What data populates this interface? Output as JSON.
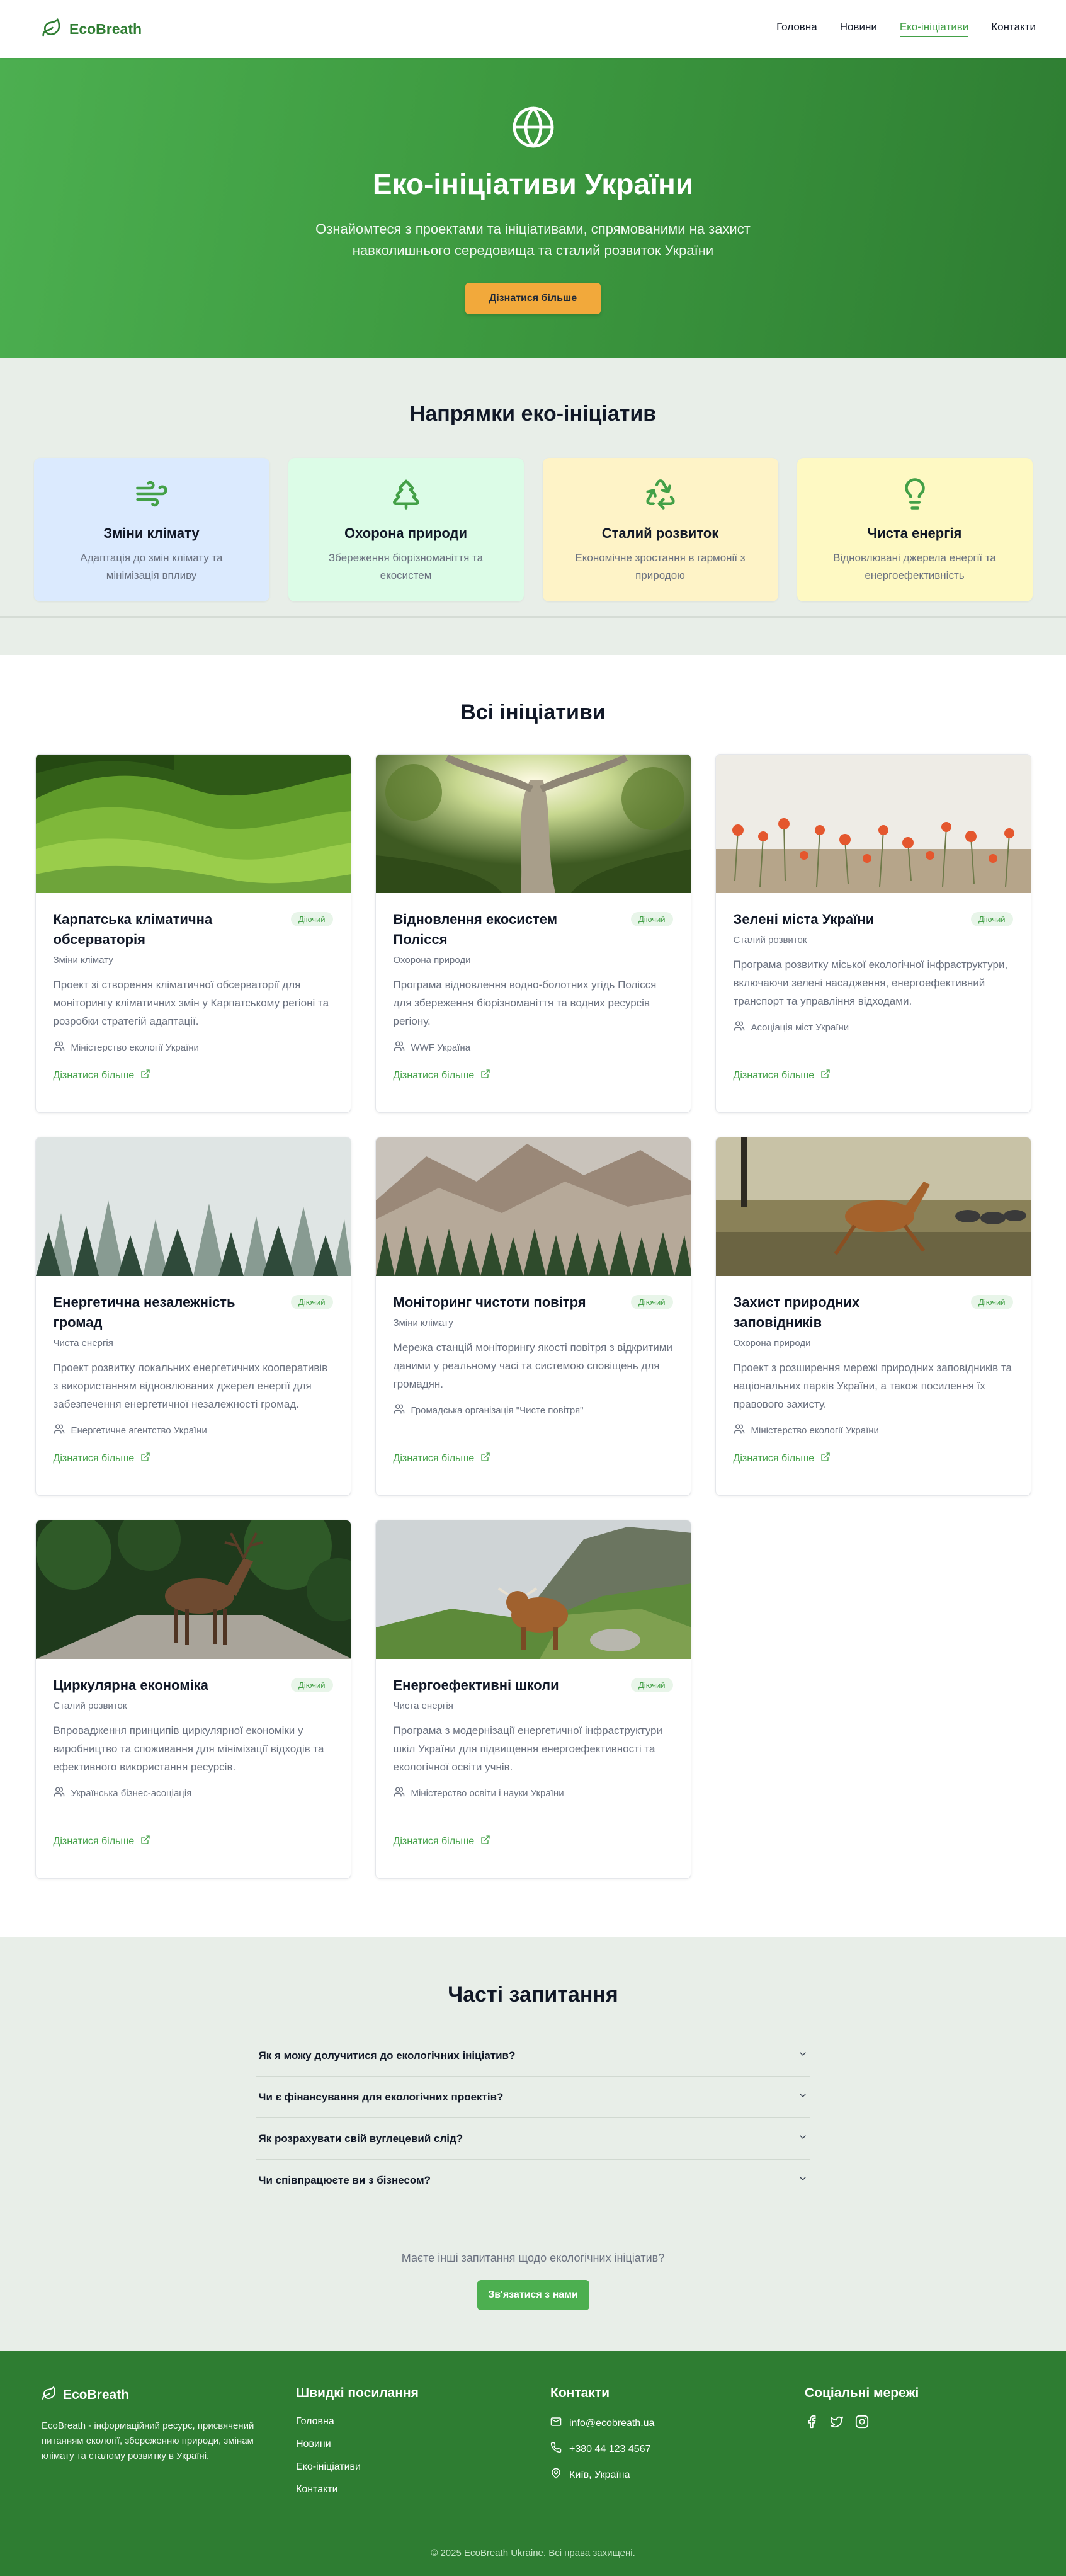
{
  "header": {
    "logo_text": "EcoBreath",
    "nav": [
      {
        "label": "Головна",
        "active": false
      },
      {
        "label": "Новини",
        "active": false
      },
      {
        "label": "Еко-ініціативи",
        "active": true
      },
      {
        "label": "Контакти",
        "active": false
      }
    ]
  },
  "hero": {
    "title": "Еко-ініціативи України",
    "subtitle": "Ознайомтеся з проектами та ініціативами, спрямованими на захист навколишнього середовища та сталий розвиток України",
    "button": "Дізнатися більше"
  },
  "directions": {
    "title": "Напрямки еко-ініціатив",
    "items": [
      {
        "icon": "wind-icon",
        "title": "Зміни клімату",
        "desc": "Адаптація до змін клімату та мінімізація впливу",
        "bg": "#dbeafe"
      },
      {
        "icon": "tree-icon",
        "title": "Охорона природи",
        "desc": "Збереження біорізноманіття та екосистем",
        "bg": "#dcfce7"
      },
      {
        "icon": "recycle-icon",
        "title": "Сталий розвиток",
        "desc": "Економічне зростання в гармонії з природою",
        "bg": "#fef3c7"
      },
      {
        "icon": "lightbulb-icon",
        "title": "Чиста енергія",
        "desc": "Відновлювані джерела енергії та енергоефективність",
        "bg": "#fef9c3"
      }
    ]
  },
  "initiatives": {
    "title": "Всі ініціативи",
    "items": [
      {
        "title": "Карпатська кліматична обсерваторія",
        "status": "Діючий",
        "category": "Зміни клімату",
        "desc": "Проект зі створення кліматичної обсерваторії для моніторингу кліматичних змін у Карпатському регіоні та розробки стратегій адаптації.",
        "org": "Міністерство екології України",
        "link": "Дізнатися більше",
        "image": "green-hills"
      },
      {
        "title": "Відновлення екосистем Полісся",
        "status": "Діючий",
        "category": "Охорона природи",
        "desc": "Програма відновлення водно-болотних угідь Полісся для збереження біорізноманіття та водних ресурсів регіону.",
        "org": "WWF Україна",
        "link": "Дізнатися більше",
        "image": "forest-sun"
      },
      {
        "title": "Зелені міста України",
        "status": "Діючий",
        "category": "Сталий розвиток",
        "desc": "Програма розвитку міської екологічної інфраструктури, включаючи зелені насадження, енергоефективний транспорт та управління відходами.",
        "org": "Асоціація міст України",
        "link": "Дізнатися більше",
        "image": "poppies"
      },
      {
        "title": "Енергетична незалежність громад",
        "status": "Діючий",
        "category": "Чиста енергія",
        "desc": "Проект розвитку локальних енергетичних кооперативів з використанням відновлюваних джерел енергії для забезпечення енергетичної незалежності громад.",
        "org": "Енергетичне агентство України",
        "link": "Дізнатися більше",
        "image": "foggy-forest"
      },
      {
        "title": "Моніторинг чистоти повітря",
        "status": "Діючий",
        "category": "Зміни клімату",
        "desc": "Мережа станцій моніторингу якості повітря з відкритими даними у реальному часі та системою сповіщень для громадян.",
        "org": "Громадська організація \"Чисте повітря\"",
        "link": "Дізнатися більше",
        "image": "mountain"
      },
      {
        "title": "Захист природних заповідників",
        "status": "Діючий",
        "category": "Охорона природи",
        "desc": "Проект з розширення мережі природних заповідників та національних парків України, а також посилення їх правового захисту.",
        "org": "Міністерство екології України",
        "link": "Дізнатися більше",
        "image": "savanna"
      },
      {
        "title": "Циркулярна економіка",
        "status": "Діючий",
        "category": "Сталий розвиток",
        "desc": "Впровадження принципів циркулярної економіки у виробництво та споживання для мінімізації відходів та ефективного використання ресурсів.",
        "org": "Українська бізнес-асоціація",
        "link": "Дізнатися більше",
        "image": "deer"
      },
      {
        "title": "Енергоефективні школи",
        "status": "Діючий",
        "category": "Чиста енергія",
        "desc": "Програма з модернізації енергетичної інфраструктури шкіл України для підвищення енергоефективності та екологічної освіти учнів.",
        "org": "Міністерство освіти і науки України",
        "link": "Дізнатися більше",
        "image": "highland"
      }
    ]
  },
  "faq": {
    "title": "Часті запитання",
    "items": [
      "Як я можу долучитися до екологічних ініціатив?",
      "Чи є фінансування для екологічних проектів?",
      "Як розрахувати свій вуглецевий слід?",
      "Чи співпрацюєте ви з бізнесом?"
    ],
    "more_text": "Маєте інші запитання щодо екологічних ініціатив?",
    "button": "Зв'язатися з нами"
  },
  "footer": {
    "brand": "EcoBreath",
    "about": "EcoBreath - інформаційний ресурс, присвячений питанням екології, збереженню природи, змінам клімату та сталому розвитку в Україні.",
    "links_title": "Швидкі посилання",
    "links": [
      "Головна",
      "Новини",
      "Еко-ініціативи",
      "Контакти"
    ],
    "contacts_title": "Контакти",
    "email": "info@ecobreath.ua",
    "phone": "+380 44 123 4567",
    "address": "Київ, Україна",
    "social_title": "Соціальні мережі",
    "socials": [
      "facebook-icon",
      "twitter-icon",
      "instagram-icon"
    ],
    "copyright": "© 2025 EcoBreath Ukraine. Всі права захищені."
  },
  "colors": {
    "brand": "#2e7d32",
    "accent": "#4caf50",
    "hero_button": "#f2a93b",
    "section_bg": "#e8eee8"
  }
}
